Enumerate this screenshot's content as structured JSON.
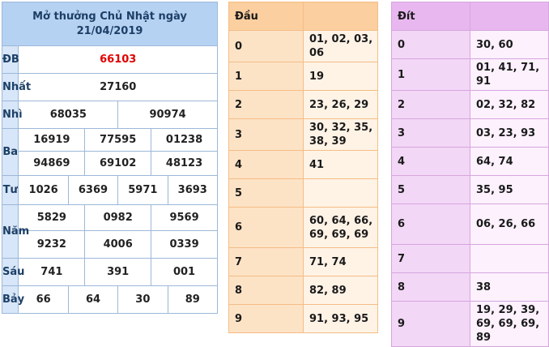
{
  "results": {
    "title_line1": "Mở thưởng Chủ Nhật ngày",
    "title_line2": "21/04/2019",
    "db": {
      "label": "ĐB",
      "values": [
        "66103"
      ]
    },
    "nhat": {
      "label": "Nhất",
      "values": [
        "27160"
      ]
    },
    "nhi": {
      "label": "Nhì",
      "values": [
        "68035",
        "90974"
      ]
    },
    "ba": {
      "label": "Ba",
      "values": [
        "16919",
        "77595",
        "01238",
        "94869",
        "69102",
        "48123"
      ]
    },
    "tu": {
      "label": "Tư",
      "values": [
        "1026",
        "6369",
        "5971",
        "3693"
      ]
    },
    "nam": {
      "label": "Năm",
      "values": [
        "5829",
        "0982",
        "9569",
        "9232",
        "4006",
        "0339"
      ]
    },
    "sau": {
      "label": "Sáu",
      "values": [
        "741",
        "391",
        "001"
      ]
    },
    "bay": {
      "label": "Bảy",
      "values": [
        "66",
        "64",
        "30",
        "89"
      ]
    },
    "colors": {
      "special": "#e00000",
      "header": "#b6d2f2",
      "label_bg": "#d7e6f8"
    }
  },
  "dau": {
    "header": "Đầu",
    "rows": [
      {
        "key": "0",
        "values": "01, 02, 03, 06"
      },
      {
        "key": "1",
        "values": "19"
      },
      {
        "key": "2",
        "values": "23, 26, 29"
      },
      {
        "key": "3",
        "values": "30, 32, 35, 38, 39"
      },
      {
        "key": "4",
        "values": "41"
      },
      {
        "key": "5",
        "values": ""
      },
      {
        "key": "6",
        "values": "60, 64, 66, 69, 69, 69"
      },
      {
        "key": "7",
        "values": "71, 74"
      },
      {
        "key": "8",
        "values": "82, 89"
      },
      {
        "key": "9",
        "values": "91, 93, 95"
      }
    ]
  },
  "dit": {
    "header": "Đít",
    "rows": [
      {
        "key": "0",
        "values": "30, 60"
      },
      {
        "key": "1",
        "values": "01, 41, 71, 91"
      },
      {
        "key": "2",
        "values": "02, 32, 82"
      },
      {
        "key": "3",
        "values": "03, 23, 93"
      },
      {
        "key": "4",
        "values": "64, 74"
      },
      {
        "key": "5",
        "values": "35, 95"
      },
      {
        "key": "6",
        "values": "06, 26, 66"
      },
      {
        "key": "7",
        "values": ""
      },
      {
        "key": "8",
        "values": "38"
      },
      {
        "key": "9",
        "values": "19, 29, 39, 69, 69, 69, 89"
      }
    ]
  }
}
